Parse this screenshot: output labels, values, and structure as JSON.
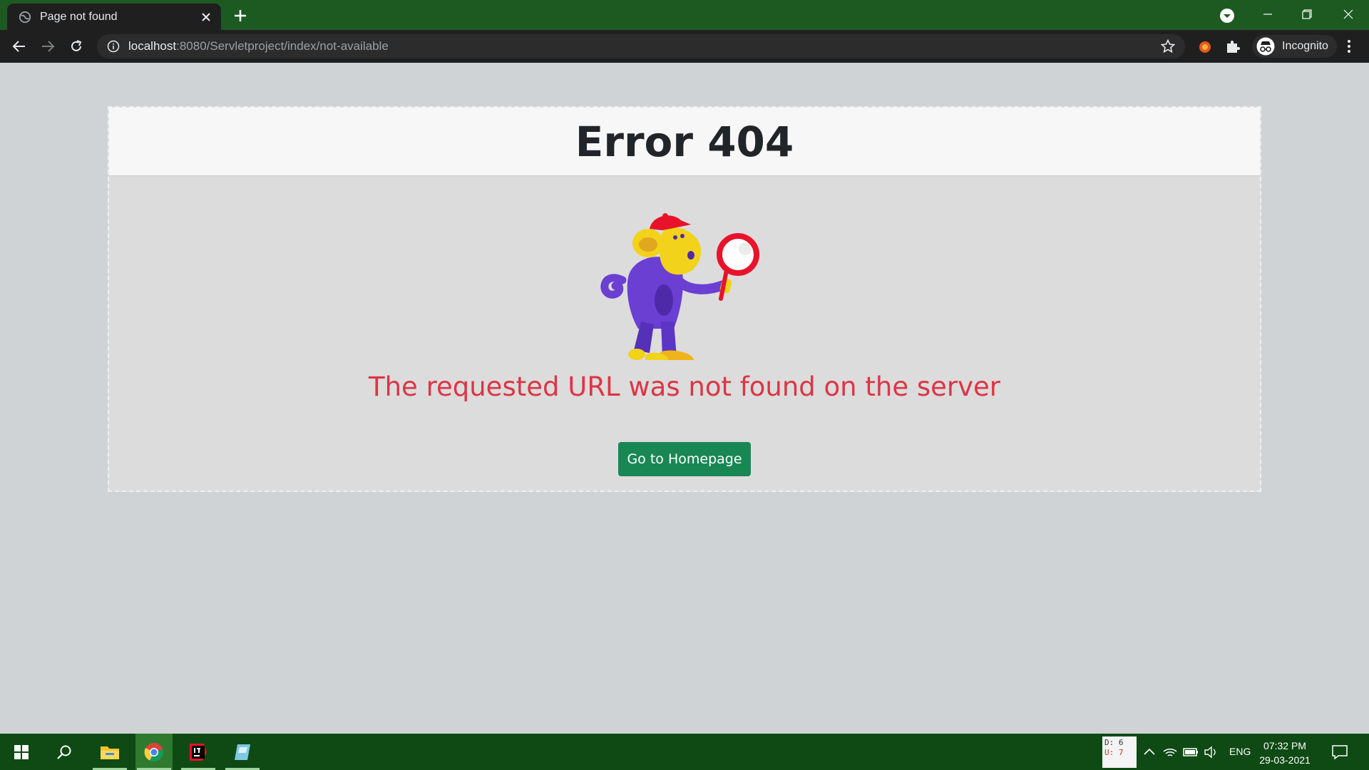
{
  "browser": {
    "tab_title": "Page not found",
    "url_host": "localhost",
    "url_rest": ":8080/Servletproject/index/not-available",
    "profile_label": "Incognito"
  },
  "page": {
    "title": "Error 404",
    "message": "The requested URL was not found on the server",
    "button_label": "Go to Homepage"
  },
  "taskbar": {
    "perf_d": "D: 6",
    "perf_u": "U: 7",
    "language": "ENG",
    "time": "07:32 PM",
    "date": "29-03-2021"
  },
  "colors": {
    "tabbar": "#1d5a22",
    "error_text": "#dc3545",
    "button": "#198754",
    "taskbar": "#0f4a14"
  },
  "icons": [
    "globe-icon",
    "close-icon",
    "plus-icon",
    "tab-search-icon",
    "minimize-icon",
    "restore-icon",
    "back-icon",
    "forward-icon",
    "reload-icon",
    "info-icon",
    "star-icon",
    "extension-icon",
    "puzzle-icon",
    "incognito-icon",
    "kebab-menu-icon",
    "windows-start-icon",
    "search-icon",
    "file-explorer-icon",
    "chrome-icon",
    "intellij-icon",
    "app-icon",
    "chevron-up-icon",
    "wifi-icon",
    "battery-icon",
    "volume-icon",
    "notification-icon"
  ]
}
